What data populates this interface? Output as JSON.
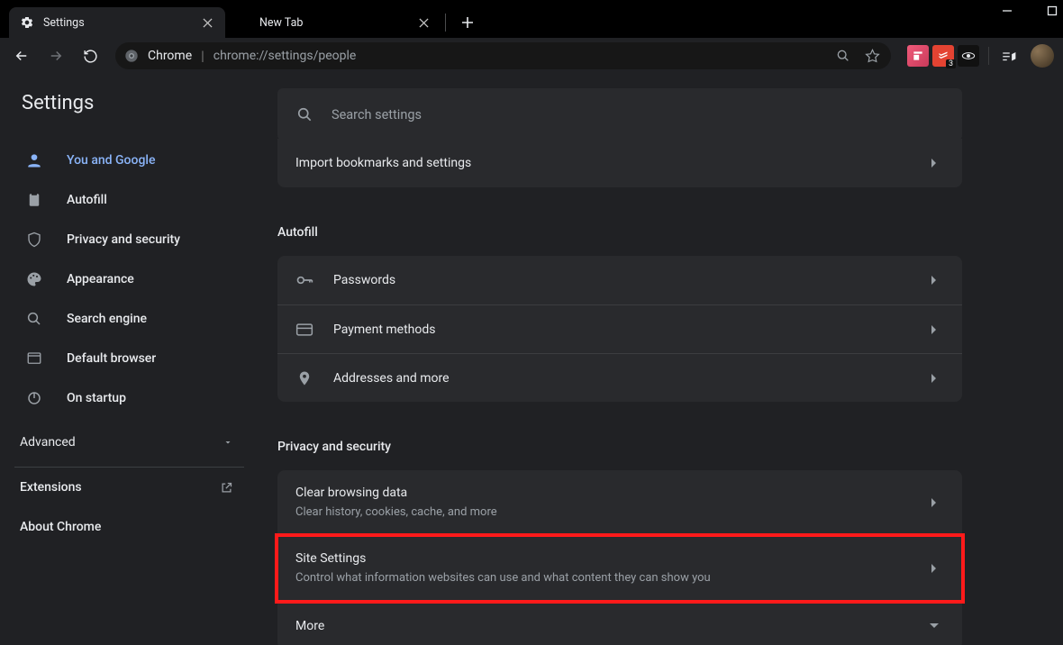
{
  "tabs": {
    "items": [
      {
        "title": "Settings",
        "active": true,
        "favicon": "gear"
      },
      {
        "title": "New Tab",
        "active": false,
        "favicon": null
      }
    ]
  },
  "omnibox": {
    "product": "Chrome",
    "url": "chrome://settings/people"
  },
  "extensions": {
    "e1_color": "#d64b6a",
    "e2_color": "#e44332",
    "e2_badge": "3",
    "e3_color": "#111"
  },
  "sidebar": {
    "title": "Settings",
    "items": [
      {
        "label": "You and Google",
        "icon": "person",
        "active": true
      },
      {
        "label": "Autofill",
        "icon": "clipboard"
      },
      {
        "label": "Privacy and security",
        "icon": "shield"
      },
      {
        "label": "Appearance",
        "icon": "palette"
      },
      {
        "label": "Search engine",
        "icon": "search"
      },
      {
        "label": "Default browser",
        "icon": "window"
      },
      {
        "label": "On startup",
        "icon": "power"
      }
    ],
    "advanced_label": "Advanced",
    "extensions_label": "Extensions",
    "about_label": "About Chrome"
  },
  "search": {
    "placeholder": "Search settings"
  },
  "main": {
    "import_row": "Import bookmarks and settings",
    "autofill": {
      "title": "Autofill",
      "rows": [
        {
          "label": "Passwords",
          "icon": "key"
        },
        {
          "label": "Payment methods",
          "icon": "card"
        },
        {
          "label": "Addresses and more",
          "icon": "pin"
        }
      ]
    },
    "privacy": {
      "title": "Privacy and security",
      "rows": [
        {
          "label": "Clear browsing data",
          "sub": "Clear history, cookies, cache, and more"
        },
        {
          "label": "Site Settings",
          "sub": "Control what information websites can use and what content they can show you",
          "highlight": true
        },
        {
          "label": "More",
          "expand": true
        }
      ]
    }
  }
}
